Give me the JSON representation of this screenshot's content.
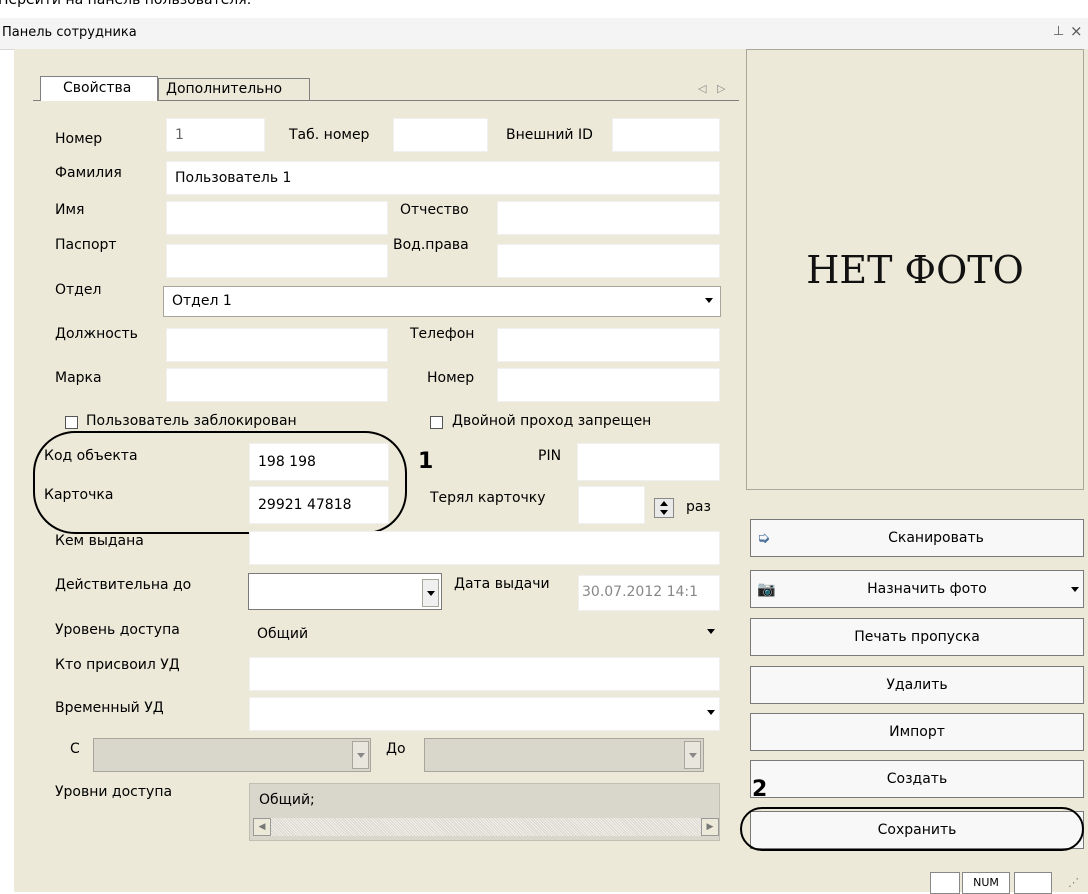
{
  "top_caption": "Перейти на панель пользователя:",
  "window": {
    "title": "Панель сотрудника",
    "pin_icon": "pin-icon",
    "close_icon": "close-icon"
  },
  "tabs": [
    {
      "label": "Свойства",
      "active": true
    },
    {
      "label": "Дополнительно",
      "active": false
    }
  ],
  "fields": {
    "nomer": {
      "label": "Номер",
      "value": "1"
    },
    "tab_nomer": {
      "label": "Таб. номер",
      "value": ""
    },
    "external_id": {
      "label": "Внешний ID",
      "value": ""
    },
    "familiya": {
      "label": "Фамилия",
      "value": "Пользователь 1"
    },
    "imya": {
      "label": "Имя",
      "value": ""
    },
    "otchestvo": {
      "label": "Отчество",
      "value": ""
    },
    "pasport": {
      "label": "Паспорт",
      "value": ""
    },
    "vod_prava": {
      "label": "Вод.права",
      "value": ""
    },
    "otdel": {
      "label": "Отдел",
      "value": "Отдел 1"
    },
    "dolzhnost": {
      "label": "Должность",
      "value": ""
    },
    "telefon": {
      "label": "Телефон",
      "value": ""
    },
    "marka": {
      "label": "Марка",
      "value": ""
    },
    "marka_nomer": {
      "label": "Номер",
      "value": ""
    },
    "blocked": {
      "label": "Пользователь заблокирован",
      "checked": false
    },
    "double_pass": {
      "label": "Двойной проход запрещен",
      "checked": false
    },
    "kod_obekta": {
      "label": "Код объекта",
      "value": "198 198"
    },
    "pin": {
      "label": "PIN",
      "value": ""
    },
    "kartochka": {
      "label": "Карточка",
      "value": "29921 47818"
    },
    "teryal": {
      "label": "Терял карточку",
      "value": "",
      "suffix": "раз"
    },
    "kem_vydana": {
      "label": "Кем выдана",
      "value": ""
    },
    "deystvitelna": {
      "label": "Действительна до",
      "value": ""
    },
    "data_vydachi": {
      "label": "Дата выдачи",
      "value": "30.07.2012 14:1"
    },
    "uroven": {
      "label": "Уровень доступа",
      "value": "Общий"
    },
    "kto_prisvoil": {
      "label": "Кто присвоил УД",
      "value": ""
    },
    "vremenny": {
      "label": "Временный УД",
      "value": ""
    },
    "s": {
      "label": "С",
      "value": ""
    },
    "do": {
      "label": "До",
      "value": ""
    },
    "urovni": {
      "label": "Уровни доступа",
      "value": "Общий;"
    }
  },
  "photo": {
    "text": "НЕТ ФОТО"
  },
  "buttons": {
    "scan": "Сканировать",
    "assign_photo": "Назначить фото",
    "print": "Печать пропуска",
    "delete": "Удалить",
    "import": "Импорт",
    "create": "Создать",
    "save": "Сохранить"
  },
  "annotations": {
    "one": "1",
    "two": "2"
  },
  "status_bar": {
    "num": "NUM"
  }
}
